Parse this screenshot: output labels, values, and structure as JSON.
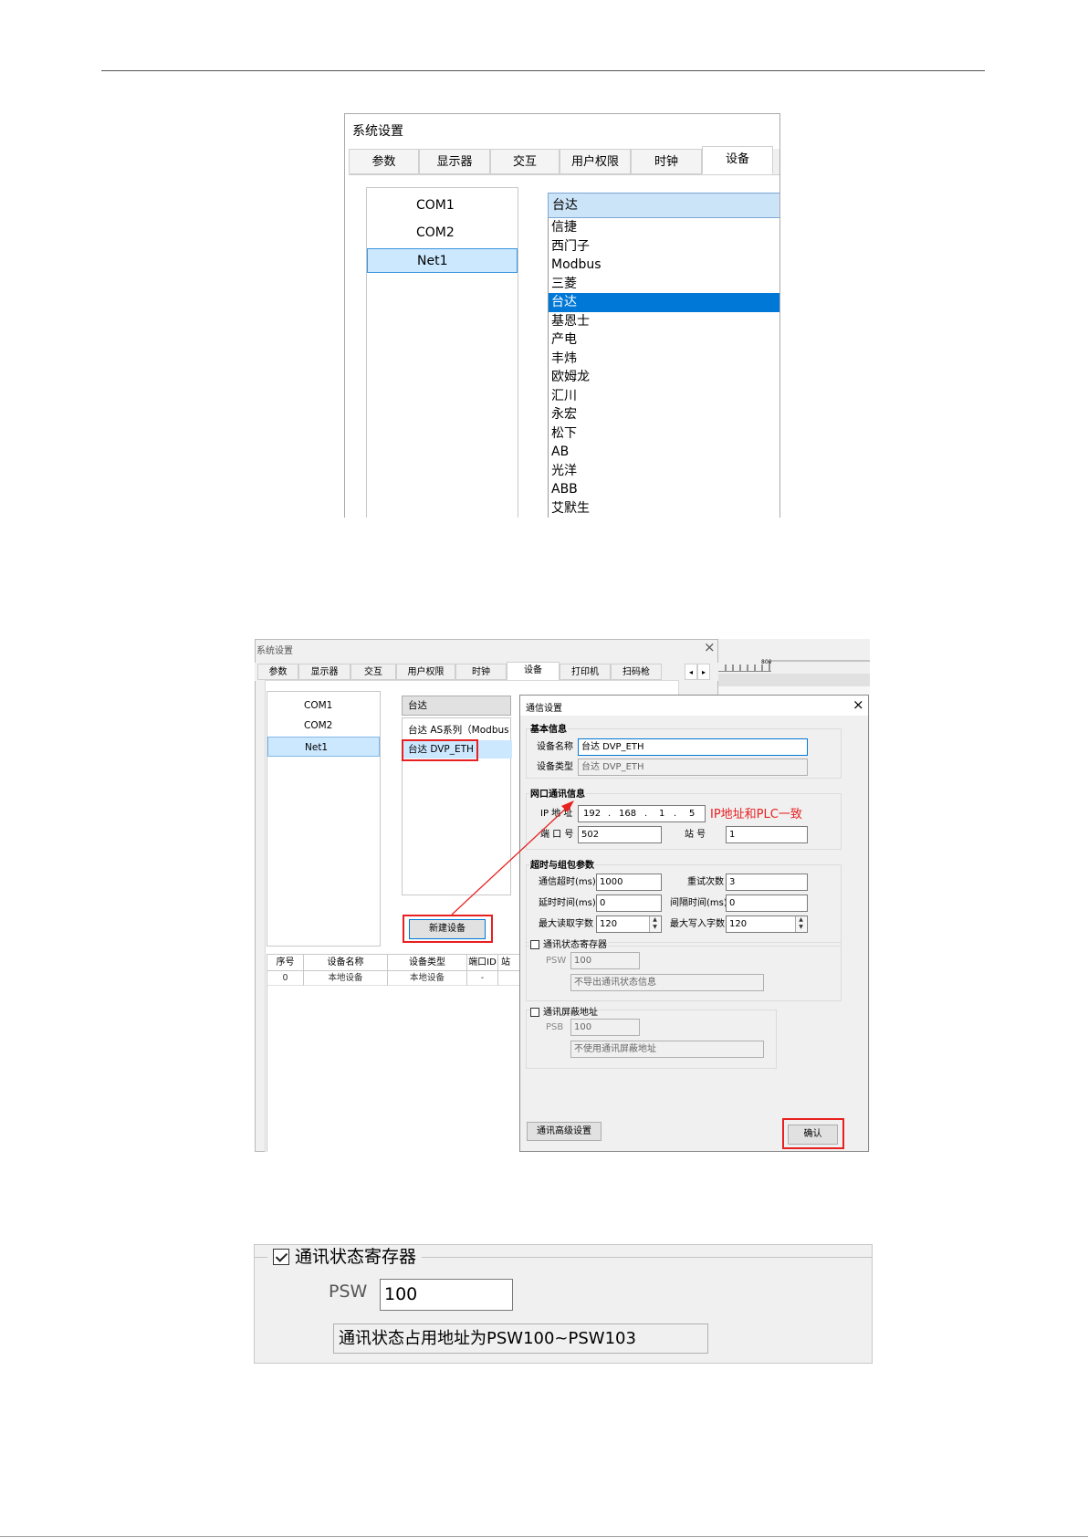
{
  "screen1": {
    "title": "系统设置",
    "tabs": [
      "参数",
      "显示器",
      "交互",
      "用户权限",
      "时钟",
      "设备"
    ],
    "active_tab": "设备",
    "ports": [
      "COM1",
      "COM2",
      "Net1"
    ],
    "selected_port": "Net1",
    "brand_dropdown_value": "台达",
    "brands": [
      "信捷",
      "西门子",
      "Modbus",
      "三菱",
      "台达",
      "基恩士",
      "产电",
      "丰炜",
      "欧姆龙",
      "汇川",
      "永宏",
      "松下",
      "AB",
      "光洋",
      "ABB",
      "艾默生"
    ],
    "highlighted_brand": "台达"
  },
  "screen2": {
    "window_title": "系统设置",
    "close_glyph": "×",
    "tabs": [
      "参数",
      "显示器",
      "交互",
      "用户权限",
      "时钟",
      "设备",
      "打印机",
      "扫码枪"
    ],
    "tab_scroll_left": "◂",
    "tab_scroll_right": "▸",
    "ruler_label": "800",
    "ports": [
      "COM1",
      "COM2",
      "Net1"
    ],
    "device_dropdown_value": "台达",
    "device_models": [
      "台达 AS系列（Modbus",
      "台达 DVP_ETH"
    ],
    "new_device_button": "新建设备",
    "table": {
      "headers": [
        "序号",
        "设备名称",
        "设备类型",
        "端口ID",
        "站"
      ],
      "rows": [
        [
          "0",
          "本地设备",
          "本地设备",
          "-",
          ""
        ]
      ]
    },
    "dialog": {
      "title": "通信设置",
      "close_glyph": "×",
      "basic_group": "基本信息",
      "device_name_label": "设备名称",
      "device_name_value": "台达 DVP_ETH",
      "device_type_label": "设备类型",
      "device_type_value": "台达 DVP_ETH",
      "net_group": "网口通讯信息",
      "ip_label": "IP 地 址",
      "ip_parts": [
        "192",
        "168",
        "1",
        "5"
      ],
      "ip_dot": ".",
      "annotation": "IP地址和PLC一致",
      "port_label": "端 口 号",
      "port_value": "502",
      "station_label": "站    号",
      "station_value": "1",
      "timeout_group": "超时与组包参数",
      "comm_timeout_label": "通信超时(ms)",
      "comm_timeout_value": "1000",
      "retry_label": "重试次数",
      "retry_value": "3",
      "delay_label": "延时时间(ms)",
      "delay_value": "0",
      "interval_label": "间隔时间(ms)",
      "interval_value": "0",
      "max_read_label": "最大读取字数",
      "max_read_value": "120",
      "max_write_label": "最大写入字数",
      "max_write_value": "120",
      "status_reg_label": "通讯状态寄存器",
      "psw_label": "PSW",
      "psw_value": "100",
      "status_reg_info": "不导出通讯状态信息",
      "mask_label": "通讯屏蔽地址",
      "psb_label": "PSB",
      "psb_value": "100",
      "mask_info": "不使用通讯屏蔽地址",
      "advanced_button": "通讯高级设置",
      "ok_button": "确认"
    }
  },
  "screen3": {
    "group_label": "通讯状态寄存器",
    "checked": true,
    "psw_label": "PSW",
    "psw_value": "100",
    "info": "通讯状态占用地址为PSW100~PSW103"
  },
  "colors": {
    "highlight_blue": "#0078d7",
    "selection_light_blue": "#cce8ff",
    "annotation_red": "#e82020"
  }
}
